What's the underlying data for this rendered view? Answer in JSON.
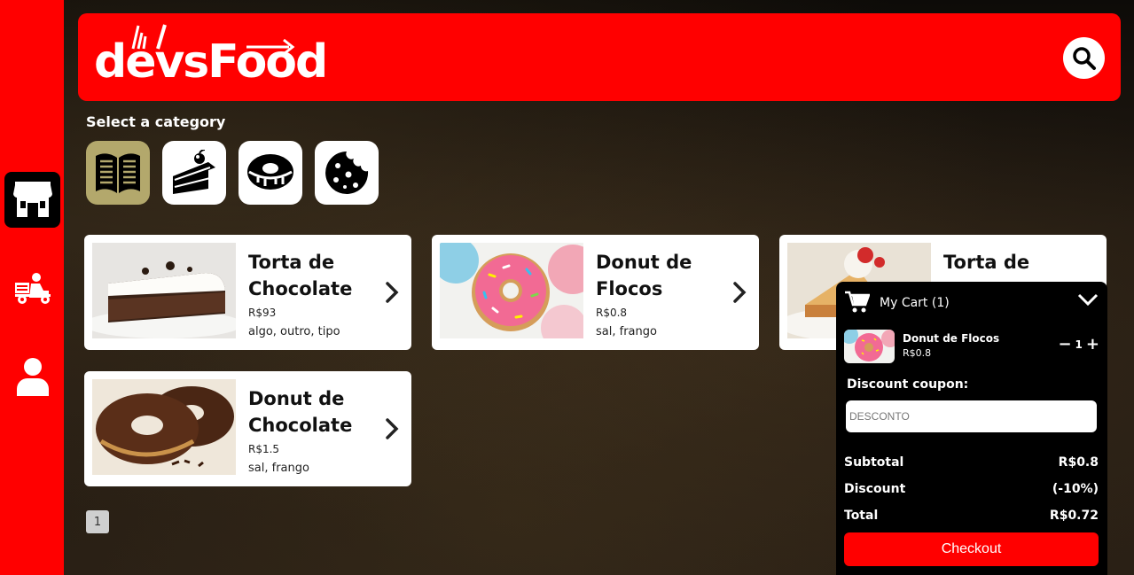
{
  "header": {
    "logo_part1": "dev",
    "logo_part2": "s",
    "logo_part3": "Food"
  },
  "sidebar": {
    "items": [
      {
        "name": "store",
        "icon": "store-icon",
        "active": true
      },
      {
        "name": "orders",
        "icon": "delivery-icon",
        "active": false
      },
      {
        "name": "profile",
        "icon": "user-icon",
        "active": false
      }
    ]
  },
  "categories": {
    "title": "Select a category",
    "items": [
      {
        "icon": "menu-book-icon",
        "active": true
      },
      {
        "icon": "cake-icon",
        "active": false
      },
      {
        "icon": "donut-icon",
        "active": false
      },
      {
        "icon": "cookie-icon",
        "active": false
      }
    ]
  },
  "products": [
    {
      "name": "Torta de Chocolate",
      "price": "R$93",
      "ingredients": "algo, outro, tipo"
    },
    {
      "name": "Donut de Flocos",
      "price": "R$0.8",
      "ingredients": "sal, frango"
    },
    {
      "name": "Torta de",
      "price": "",
      "ingredients": ""
    },
    {
      "name": "Donut de Chocolate",
      "price": "R$1.5",
      "ingredients": "sal, frango"
    }
  ],
  "pagination": {
    "current": "1"
  },
  "cart": {
    "title": "My Cart (1)",
    "item": {
      "name": "Donut de Flocos",
      "price": "R$0.8",
      "qty": "1"
    },
    "coupon_label": "Discount coupon:",
    "coupon_placeholder": "DESCONTO",
    "subtotal_label": "Subtotal",
    "subtotal_value": "R$0.8",
    "discount_label": "Discount",
    "discount_value": "(-10%)",
    "total_label": "Total",
    "total_value": "R$0.72",
    "checkout_label": "Checkout"
  },
  "colors": {
    "brand": "#ff0000",
    "category_active": "#b3a86c"
  }
}
